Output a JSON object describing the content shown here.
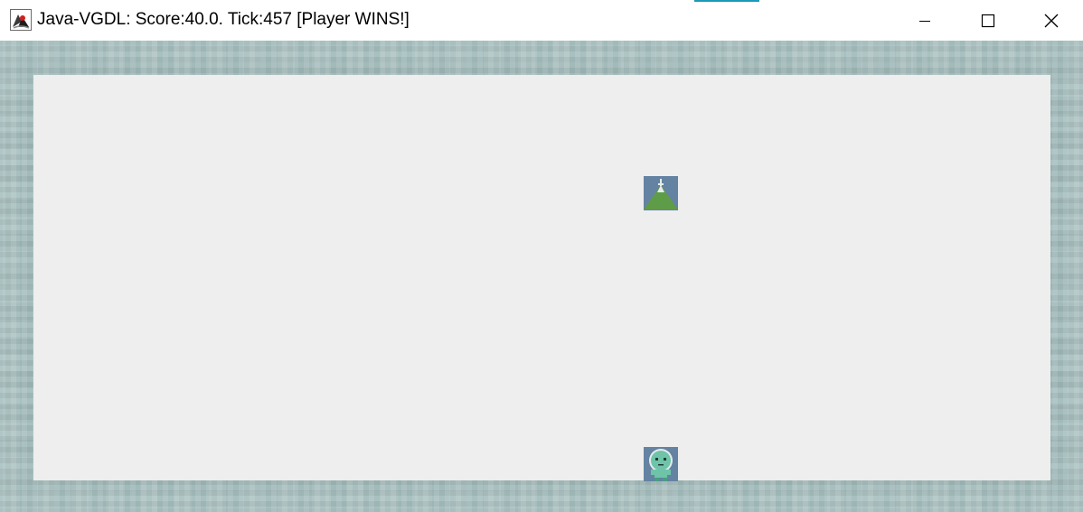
{
  "window": {
    "title": "Java-VGDL: Score:40.0. Tick:457 [Player WINS!]",
    "icon": "java-duke-icon",
    "controls": {
      "minimize": "minimize-icon",
      "maximize": "maximize-icon",
      "close": "close-icon"
    },
    "accent_color": "#1a9ab8"
  },
  "game": {
    "wall_color": "#a8c0c0",
    "floor_color": "#eeeeee",
    "sprites": [
      {
        "name": "goal-sprite",
        "icon": "green-mountain-icon"
      },
      {
        "name": "avatar-sprite",
        "icon": "green-alien-icon"
      }
    ]
  }
}
